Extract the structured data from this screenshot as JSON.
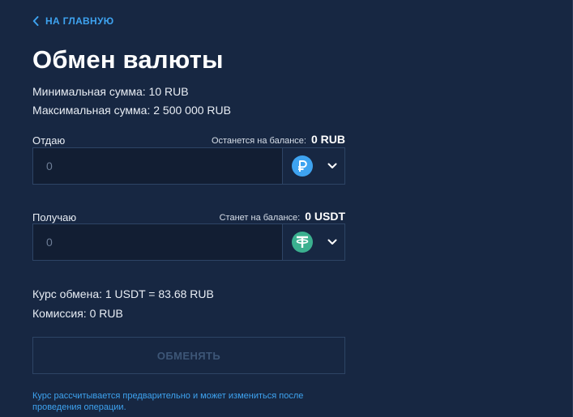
{
  "nav": {
    "back_label": "НА ГЛАВНУЮ"
  },
  "page": {
    "title": "Обмен валюты"
  },
  "limits": {
    "min": "Минимальная сумма: 10 RUB",
    "max": "Максимальная сумма: 2 500 000 RUB"
  },
  "give": {
    "label": "Отдаю",
    "balance_caption": "Останется на балансе:",
    "balance_value": "0 RUB",
    "placeholder": "0",
    "currency": "RUB",
    "currency_icon": "ruble-coin-icon",
    "currency_color": "#3ea3f0"
  },
  "receive": {
    "label": "Получаю",
    "balance_caption": "Станет на балансе:",
    "balance_value": "0 USDT",
    "placeholder": "0",
    "currency": "USDT",
    "currency_icon": "tether-coin-icon",
    "currency_color": "#3bb08f"
  },
  "rates": {
    "rate": "Курс обмена: 1 USDT = 83.68 RUB",
    "fee": "Комиссия: 0 RUB"
  },
  "action": {
    "exchange_label": "ОБМЕНЯТЬ"
  },
  "disclaimer": "Курс рассчитывается предварительно и может измениться после проведения операции.",
  "colors": {
    "background": "#172742",
    "accent": "#3ea3f0",
    "field_border": "#2d4465",
    "input_background": "#121e33",
    "disabled_text": "#3d5677"
  }
}
